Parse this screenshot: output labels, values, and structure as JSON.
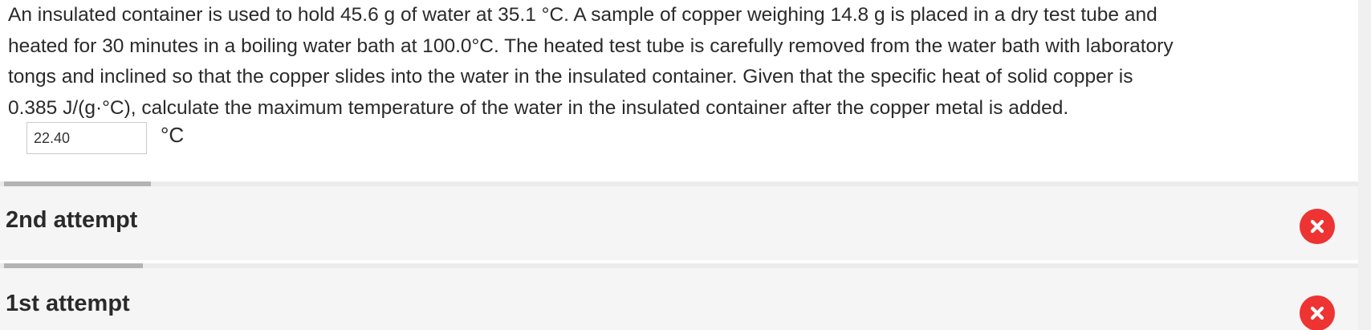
{
  "question": {
    "lines": [
      "An insulated container is used to hold 45.6  g of water at 35.1 °C. A sample of copper weighing 14.8  g is placed in a dry test tube and",
      "heated for 30 minutes in a boiling water bath at 100.0°C. The heated test tube is carefully removed from the water bath with laboratory",
      "tongs and inclined so that the copper slides into the water in the insulated container. Given that the specific heat of solid copper is",
      "0.385 J/(g·°C), calculate the maximum temperature of the water in the insulated container after the copper metal is added."
    ]
  },
  "answer": {
    "value": "22.40",
    "unit": "°C"
  },
  "attempts": [
    {
      "label": "2nd attempt",
      "status": "incorrect",
      "icon": "incorrect-icon",
      "color": "#ee3333"
    },
    {
      "label": "1st attempt",
      "status": "incorrect",
      "icon": "incorrect-icon",
      "color": "#ee3333"
    }
  ]
}
